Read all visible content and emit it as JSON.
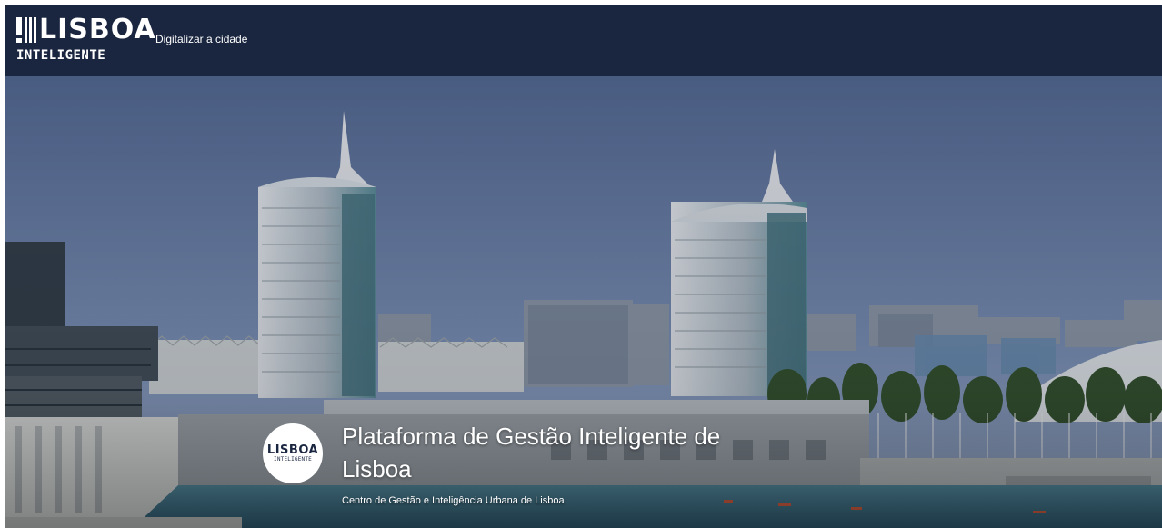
{
  "header": {
    "logo_main": "LISBOA",
    "logo_sub": "INTELIGENTE",
    "nav_link": "Digitalizar a cidade"
  },
  "hero": {
    "logo_main": "LISBOA",
    "logo_sub": "INTELIGENTE",
    "title": "Plataforma de Gestão Inteligente de Lisboa",
    "subtitle": "Centro de Gestão e Inteligência Urbana de Lisboa"
  },
  "colors": {
    "header_bg": "#1a2640",
    "sky_top": "#4a5d82",
    "sky_bottom": "#7d8fae",
    "water": "#3a6e86"
  }
}
